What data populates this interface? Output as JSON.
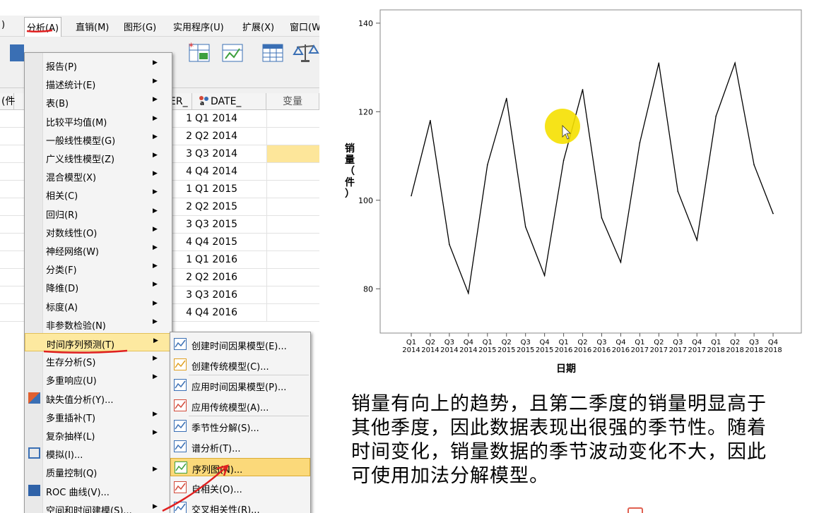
{
  "menubar": {
    "items": [
      "分析(A)",
      "直销(M)",
      "图形(G)",
      "实用程序(U)",
      "扩展(X)",
      "窗口(W"
    ],
    "partial_left": ")"
  },
  "grid": {
    "headers": {
      "var_partial": "ER_",
      "date": "DATE_",
      "new_var": "变量",
      "left_partial": "(件"
    },
    "rows": [
      {
        "n": "1",
        "date": "Q1 2014"
      },
      {
        "n": "2",
        "date": "Q2 2014"
      },
      {
        "n": "3",
        "date": "Q3 2014"
      },
      {
        "n": "4",
        "date": "Q4 2014"
      },
      {
        "n": "1",
        "date": "Q1 2015"
      },
      {
        "n": "2",
        "date": "Q2 2015"
      },
      {
        "n": "3",
        "date": "Q3 2015"
      },
      {
        "n": "4",
        "date": "Q4 2015"
      },
      {
        "n": "1",
        "date": "Q1 2016"
      },
      {
        "n": "2",
        "date": "Q2 2016"
      },
      {
        "n": "3",
        "date": "Q3 2016"
      },
      {
        "n": "4",
        "date": "Q4 2016"
      }
    ]
  },
  "analyze_menu": {
    "items": [
      "报告(P)",
      "描述统计(E)",
      "表(B)",
      "比较平均值(M)",
      "一般线性模型(G)",
      "广义线性模型(Z)",
      "混合模型(X)",
      "相关(C)",
      "回归(R)",
      "对数线性(O)",
      "神经网络(W)",
      "分类(F)",
      "降维(D)",
      "标度(A)",
      "非参数检验(N)",
      "时间序列预测(T)",
      "生存分析(S)",
      "多重响应(U)",
      "缺失值分析(Y)...",
      "多重插补(T)",
      "复杂抽样(L)",
      "模拟(I)...",
      "质量控制(Q)",
      "ROC 曲线(V)...",
      "空间和时间建模(S)..."
    ]
  },
  "ts_submenu": {
    "items": [
      "创建时间因果模型(E)...",
      "创建传统模型(C)...",
      "应用时间因果模型(P)...",
      "应用传统模型(A)...",
      "季节性分解(S)...",
      "谱分析(T)...",
      "序列图(N)...",
      "自相关(O)...",
      "交叉相关性(R)..."
    ]
  },
  "chart_data": {
    "type": "line",
    "x": [
      "Q1 2014",
      "Q2 2014",
      "Q3 2014",
      "Q4 2014",
      "Q1 2015",
      "Q2 2015",
      "Q3 2015",
      "Q4 2015",
      "Q1 2016",
      "Q2 2016",
      "Q3 2016",
      "Q4 2016",
      "Q1 2017",
      "Q2 2017",
      "Q3 2017",
      "Q4 2017",
      "Q1 2018",
      "Q2 2018",
      "Q3 2018",
      "Q4 2018"
    ],
    "x_quarter": [
      "Q1",
      "Q2",
      "Q3",
      "Q4",
      "Q1",
      "Q2",
      "Q3",
      "Q4",
      "Q1",
      "Q2",
      "Q3",
      "Q4",
      "Q1",
      "Q2",
      "Q3",
      "Q4",
      "Q1",
      "Q2",
      "Q3",
      "Q4"
    ],
    "x_year": [
      "2014",
      "2014",
      "2014",
      "2014",
      "2015",
      "2015",
      "2015",
      "2015",
      "2016",
      "2016",
      "2016",
      "2016",
      "2017",
      "2017",
      "2017",
      "2017",
      "2018",
      "2018",
      "2018",
      "2018"
    ],
    "values": [
      101,
      118,
      90,
      79,
      108,
      123,
      94,
      83,
      109,
      125,
      96,
      86,
      113,
      131,
      102,
      91,
      119,
      131,
      108,
      97
    ],
    "xlabel": "日期",
    "ylabel": "销量（件）",
    "yticks": [
      80,
      100,
      120,
      140
    ],
    "ylim": [
      70,
      143
    ],
    "grid": false
  },
  "caption": {
    "lines": [
      "销量有向上的趋势，且第二季度的销量明显高于",
      "其他季度，因此数据表现出很强的季节性。随着",
      "时间变化，销量数据的季节波动变化不大，因此",
      "可使用加法分解模型。"
    ]
  },
  "colors": {
    "highlight": "#fbd97a",
    "cursor_highlight": "#f5e000",
    "annotation_red": "#e02020",
    "line": "#000000"
  }
}
